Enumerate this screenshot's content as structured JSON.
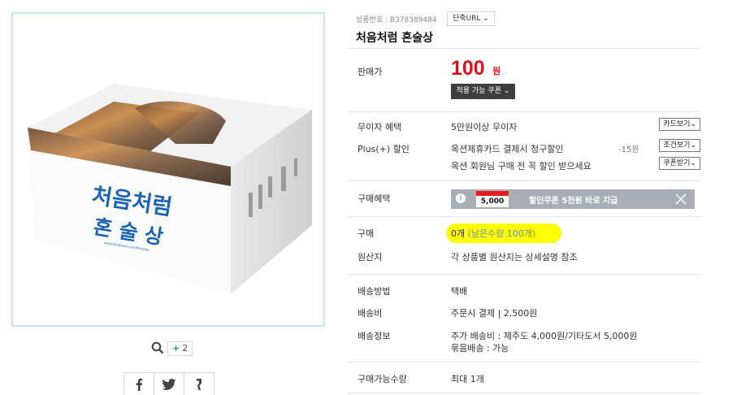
{
  "product": {
    "number_label": "상품번호 : B378389484",
    "url_button": "단축URL",
    "title": "처음처럼 혼술상",
    "image_text_line1": "처음처럼",
    "image_text_line2": "혼 술 상",
    "image_url_text": "www.facebook.com/firstsoju",
    "plus_count": "2"
  },
  "price": {
    "label": "판매가",
    "amount": "100",
    "unit": "원",
    "coupon_button": "적용 가능 쿠폰"
  },
  "benefits": {
    "interest_free_label": "무이자 혜택",
    "interest_free_value": "5만원이상 무이자",
    "card_view_button": "카드보기",
    "plus_label": "Plus(+) 할인",
    "plus_value": "옥션제휴카드 결제시 청구할인",
    "plus_discount": "-15원",
    "condition_button": "조건보기",
    "member_value": "옥션 회원님 구매 전 꼭 할인 받으세요",
    "coupon_get_button": "쿠폰받기"
  },
  "purchase_benefit": {
    "label": "구매혜택",
    "card_amount": "5,000",
    "banner_text": "할인쿠폰 5천원 바로 지급"
  },
  "purchase": {
    "label": "구매",
    "qty": "0개",
    "remain": "(남은수량 100개)",
    "origin_label": "원산지",
    "origin_value": "각 상품별 원산지는 상세설명 참조"
  },
  "shipping": {
    "method_label": "배송방법",
    "method_value": "택배",
    "fee_label": "배송비",
    "fee_value": "주문시 결제 | 2,500원",
    "info_label": "배송정보",
    "info_line1": "추가 배송비 : 제주도 4,000원/기타도서 5,000원",
    "info_line2": "묶음배송 : 가능"
  },
  "limit": {
    "label": "구매가능수량",
    "value": "최대 1개"
  },
  "colors": {
    "price_red": "#d9121e",
    "highlight": "#ffff00",
    "box_blue": "#1b64b4"
  }
}
